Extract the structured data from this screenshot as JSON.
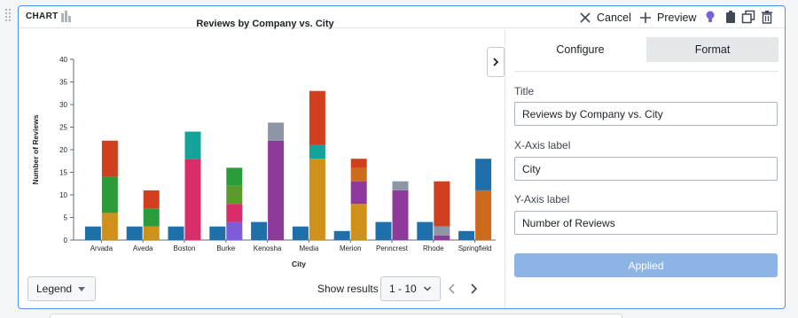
{
  "header": {
    "title": "CHART",
    "cancel_label": "Cancel",
    "preview_label": "Preview"
  },
  "sidebar": {
    "tabs": [
      {
        "label": "Configure",
        "active": true
      },
      {
        "label": "Format",
        "active": false
      }
    ],
    "title_label": "Title",
    "title_value": "Reviews by Company vs. City",
    "xaxis_label": "X-Axis label",
    "xaxis_value": "City",
    "yaxis_label": "Y-Axis label",
    "yaxis_value": "Number of Reviews",
    "applied_label": "Applied"
  },
  "footer": {
    "legend_label": "Legend",
    "show_results_label": "Show results",
    "page_range": "1 - 10"
  },
  "icons": [
    "drag-handle-icon",
    "chart-icon",
    "cross-icon",
    "plus-icon",
    "lightbulb-icon",
    "clipboard-icon",
    "duplicate-icon",
    "trash-icon",
    "chevron-right-icon",
    "caret-down-icon",
    "chevron-down-icon",
    "chevron-left-icon"
  ],
  "colors": {
    "accent": "#4c90f0",
    "applied": "#8eb3e5",
    "seg_blue": "#1f6fab",
    "seg_orange": "#d0911a",
    "seg_green": "#2a9d3a",
    "seg_red": "#d1401e",
    "seg_teal": "#14a398",
    "seg_pink": "#d92d6b",
    "seg_olive": "#5c9a2b",
    "seg_purple": "#7e5bd9",
    "seg_magenta": "#8e3a9b",
    "seg_gray": "#8c96a4",
    "seg_brown": "#cc6a1e"
  },
  "chart_data": {
    "type": "bar",
    "stacked": true,
    "title": "Reviews by Company vs. City",
    "xlabel": "City",
    "ylabel": "Number of Reviews",
    "ylim": [
      0,
      40
    ],
    "yticks": [
      0,
      5,
      10,
      15,
      20,
      25,
      30,
      35,
      40
    ],
    "grid": false,
    "categories": [
      "Arvada",
      "Aveda",
      "Boston",
      "Burke",
      "Kenosha",
      "Media",
      "Merion",
      "Penncrest",
      "Rhode",
      "Springfield"
    ],
    "groups": [
      {
        "category": "Arvada",
        "bars": [
          [
            {
              "v": 3,
              "c": "seg_blue"
            }
          ],
          [
            {
              "v": 6,
              "c": "seg_orange"
            },
            {
              "v": 8,
              "c": "seg_green"
            },
            {
              "v": 8,
              "c": "seg_red"
            }
          ]
        ]
      },
      {
        "category": "Aveda",
        "bars": [
          [
            {
              "v": 3,
              "c": "seg_blue"
            }
          ],
          [
            {
              "v": 3,
              "c": "seg_orange"
            },
            {
              "v": 4,
              "c": "seg_green"
            },
            {
              "v": 4,
              "c": "seg_red"
            }
          ]
        ]
      },
      {
        "category": "Boston",
        "bars": [
          [
            {
              "v": 3,
              "c": "seg_blue"
            }
          ],
          [
            {
              "v": 18,
              "c": "seg_pink"
            },
            {
              "v": 6,
              "c": "seg_teal"
            }
          ]
        ]
      },
      {
        "category": "Burke",
        "bars": [
          [
            {
              "v": 3,
              "c": "seg_blue"
            }
          ],
          [
            {
              "v": 4,
              "c": "seg_purple"
            },
            {
              "v": 4,
              "c": "seg_pink"
            },
            {
              "v": 4,
              "c": "seg_olive"
            },
            {
              "v": 4,
              "c": "seg_green"
            }
          ]
        ]
      },
      {
        "category": "Kenosha",
        "bars": [
          [
            {
              "v": 4,
              "c": "seg_blue"
            }
          ],
          [
            {
              "v": 22,
              "c": "seg_magenta"
            },
            {
              "v": 4,
              "c": "seg_gray"
            }
          ]
        ]
      },
      {
        "category": "Media",
        "bars": [
          [
            {
              "v": 3,
              "c": "seg_blue"
            }
          ],
          [
            {
              "v": 18,
              "c": "seg_orange"
            },
            {
              "v": 3,
              "c": "seg_teal"
            },
            {
              "v": 12,
              "c": "seg_red"
            }
          ]
        ]
      },
      {
        "category": "Merion",
        "bars": [
          [
            {
              "v": 2,
              "c": "seg_blue"
            }
          ],
          [
            {
              "v": 8,
              "c": "seg_orange"
            },
            {
              "v": 5,
              "c": "seg_magenta"
            },
            {
              "v": 3,
              "c": "seg_brown"
            },
            {
              "v": 2,
              "c": "seg_red"
            }
          ]
        ]
      },
      {
        "category": "Penncrest",
        "bars": [
          [
            {
              "v": 4,
              "c": "seg_blue"
            }
          ],
          [
            {
              "v": 11,
              "c": "seg_magenta"
            },
            {
              "v": 2,
              "c": "seg_gray"
            }
          ]
        ]
      },
      {
        "category": "Rhode",
        "bars": [
          [
            {
              "v": 4,
              "c": "seg_blue"
            }
          ],
          [
            {
              "v": 1,
              "c": "seg_magenta"
            },
            {
              "v": 2,
              "c": "seg_gray"
            },
            {
              "v": 10,
              "c": "seg_red"
            }
          ]
        ]
      },
      {
        "category": "Springfield",
        "bars": [
          [
            {
              "v": 2,
              "c": "seg_blue"
            }
          ],
          [
            {
              "v": 11,
              "c": "seg_brown"
            },
            {
              "v": 7,
              "c": "seg_blue"
            }
          ]
        ]
      }
    ]
  }
}
